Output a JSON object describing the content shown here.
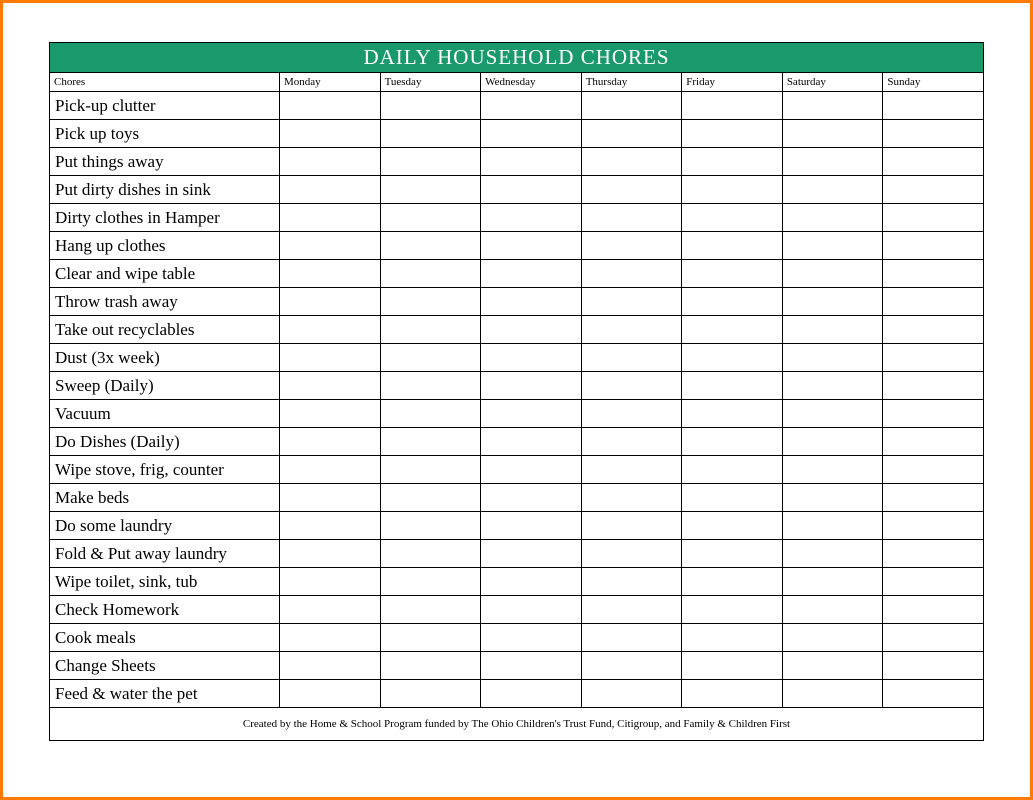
{
  "title": "DAILY HOUSEHOLD CHORES",
  "headers": [
    "Chores",
    "Monday",
    "Tuesday",
    "Wednesday",
    "Thursday",
    "Friday",
    "Saturday",
    "Sunday"
  ],
  "chores": [
    "Pick-up clutter",
    "Pick up toys",
    "Put things away",
    "Put dirty dishes in sink",
    "Dirty clothes in Hamper",
    "Hang up clothes",
    "Clear and wipe table",
    "Throw trash away",
    "Take out recyclables",
    "Dust (3x week)",
    "Sweep (Daily)",
    "Vacuum",
    "Do Dishes (Daily)",
    "Wipe stove, frig, counter",
    "Make beds",
    "Do some laundry",
    "Fold & Put away laundry",
    "Wipe toilet, sink, tub",
    "Check Homework",
    "Cook meals",
    "Change Sheets",
    "Feed & water the pet"
  ],
  "footer": "Created by the Home & School Program funded by The Ohio Children's Trust Fund, Citigroup, and Family & Children First",
  "colors": {
    "brand_green": "#1a9a6c",
    "border_orange": "#ff7a00"
  }
}
